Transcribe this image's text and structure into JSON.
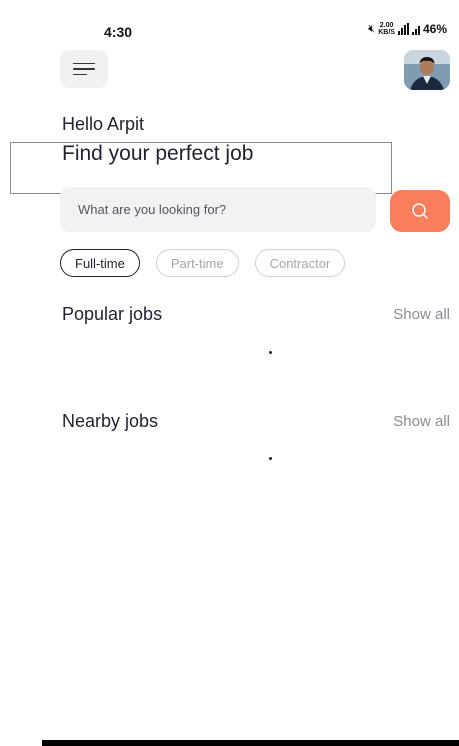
{
  "status_bar": {
    "time": "4:30",
    "net_speed_top": "2.00",
    "net_speed_bottom": "KB/S",
    "battery": "46%"
  },
  "header": {
    "greeting": "Hello Arpit",
    "headline": "Find your perfect job"
  },
  "search": {
    "placeholder": "What are you looking for?"
  },
  "filters": [
    {
      "label": "Full-time",
      "selected": true
    },
    {
      "label": "Part-time",
      "selected": false
    },
    {
      "label": "Contractor",
      "selected": false
    }
  ],
  "sections": {
    "popular": {
      "title": "Popular jobs",
      "show_all": "Show all"
    },
    "nearby": {
      "title": "Nearby jobs",
      "show_all": "Show all"
    }
  },
  "colors": {
    "accent": "#fb7d5b",
    "text_primary": "#1f2230",
    "text_muted": "#8b8d95",
    "input_bg": "#f2f2f5"
  },
  "icons": {
    "menu": "hamburger-menu-icon",
    "search": "search-icon",
    "mute": "mute-icon",
    "signal": "signal-icon"
  }
}
